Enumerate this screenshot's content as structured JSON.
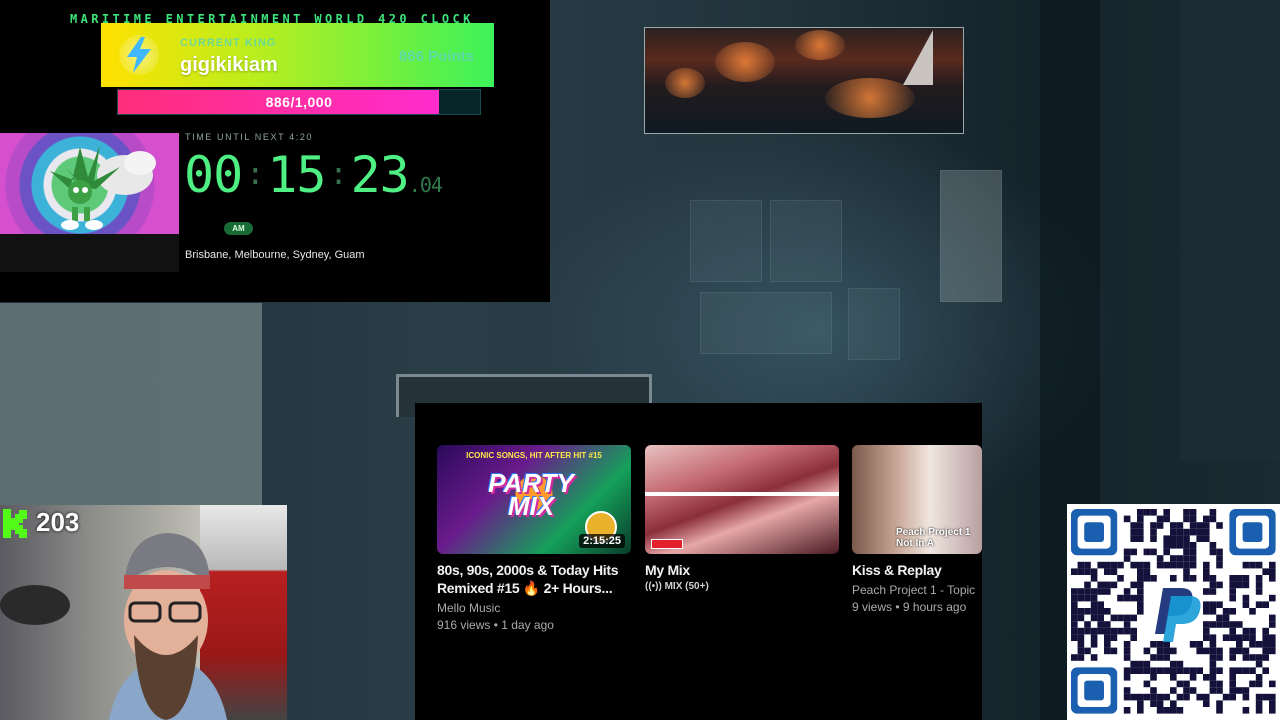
{
  "clock": {
    "title": "MARITIME ENTERTAINMENT WORLD 420 CLOCK",
    "king_label": "CURRENT KING",
    "king_name": "gigikikiam",
    "king_points": "886 Points",
    "progress_text": "886/1,000",
    "progress_fraction": 0.886,
    "until_label": "TIME UNTIL NEXT 4:20",
    "hours": "00",
    "minutes": "15",
    "seconds": "23",
    "hundredths": ".04",
    "ampm": "AM",
    "cities": "Brisbane, Melbourne, Sydney, Guam"
  },
  "youtube": {
    "videos": [
      {
        "thumb_caption": "ICONIC SONGS, HIT AFTER HIT #15",
        "thumb_big": "PARTY MIX",
        "duration": "2:15:25",
        "title": "80s, 90s, 2000s & Today Hits\nRemixed #15 🔥 2+ Hours...",
        "channel": "Mello Music",
        "meta": "916 views • 1 day ago"
      },
      {
        "title": "My Mix",
        "badge": "((•)) MIX (50+)"
      },
      {
        "thumb_text": "Peach Project 1\nNot In A",
        "title": "Kiss & Replay",
        "channel": "Peach Project 1 - Topic",
        "meta": "9 views • 9 hours ago"
      }
    ]
  },
  "webcam": {
    "viewer_count": "203"
  },
  "colors": {
    "clock_green": "#4ff083",
    "progress_pink": "#ff2e7a",
    "kick_green": "#53fc18"
  },
  "icons": [
    "lightning-icon",
    "kick-logo-icon",
    "paypal-qr-code"
  ]
}
